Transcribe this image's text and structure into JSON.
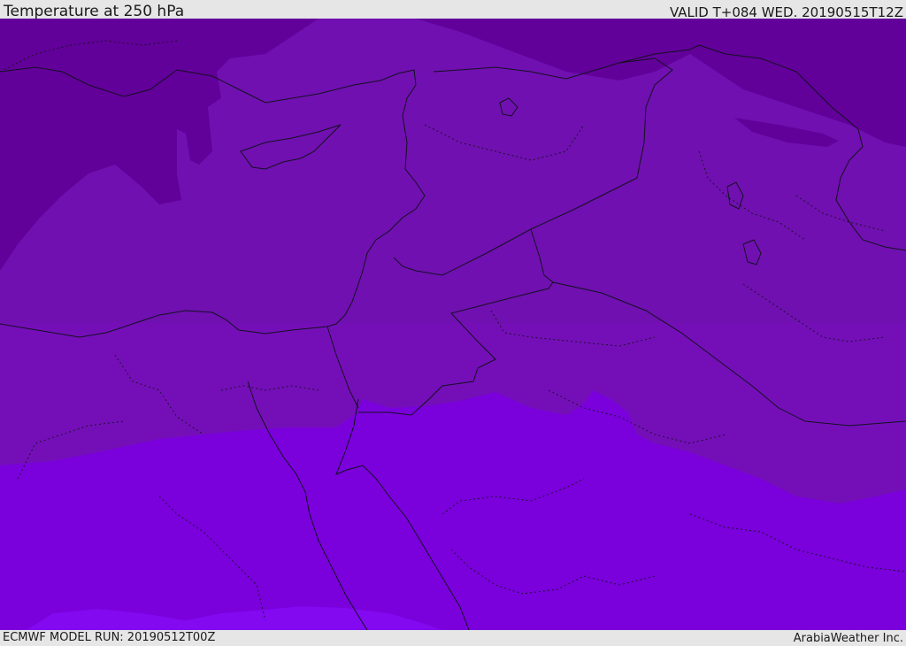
{
  "header": {
    "title": "Temperature at 250 hPa",
    "valid_time": "VALID T+084 WED. 20190515T12Z"
  },
  "footer": {
    "model_run": "ECMWF MODEL RUN: 20190512T00Z",
    "brand": "ArabiaWeather Inc."
  },
  "map": {
    "colors": {
      "coldest": "#62009a",
      "cold": "#7010b0",
      "mid": "#780ec0",
      "warm": "#7a00dc",
      "warmest": "#8209f0",
      "borders": "#141020",
      "admin_borders": "#1e1028"
    }
  }
}
